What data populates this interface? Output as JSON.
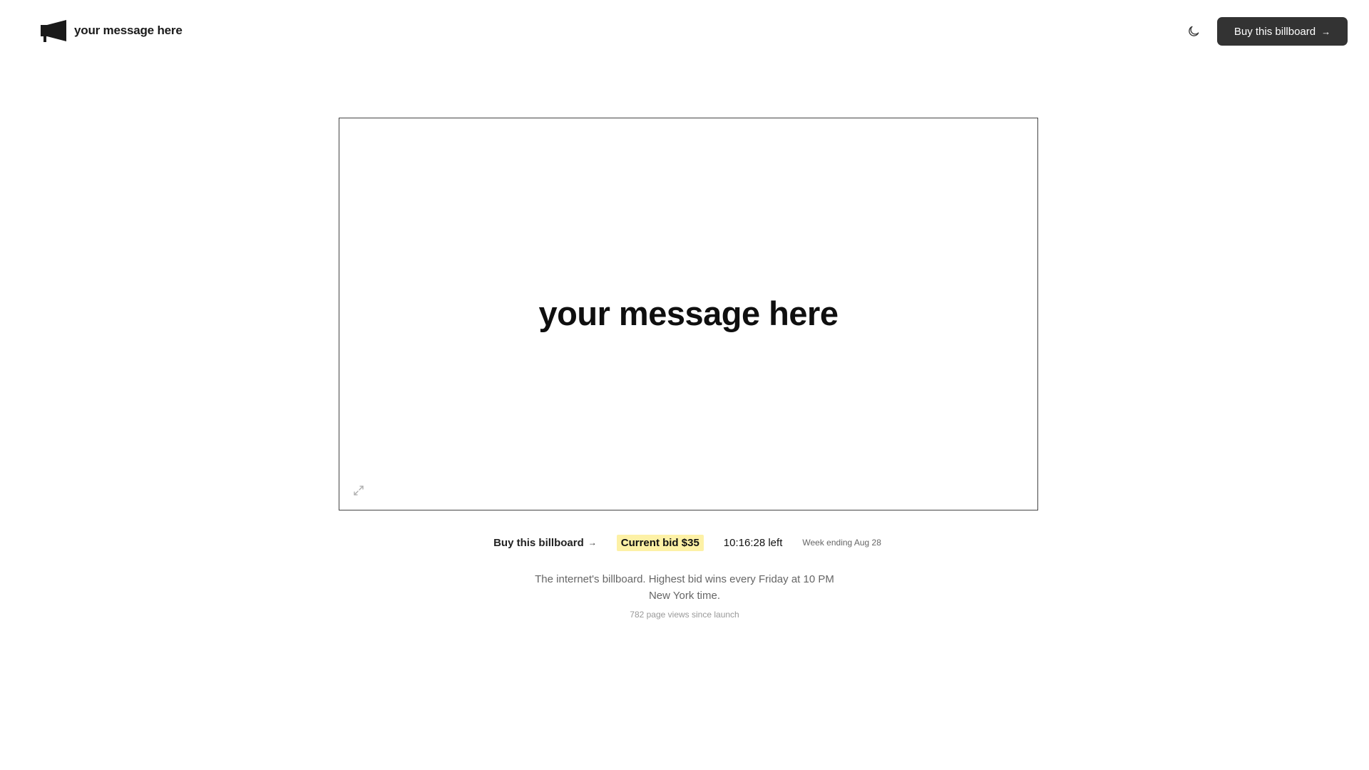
{
  "header": {
    "brand_name": "your message here",
    "logo_icon": "megaphone-icon",
    "theme_toggle_icon": "moon-icon",
    "buy_button_label": "Buy this billboard",
    "buy_button_arrow": "→"
  },
  "billboard": {
    "message": "your message here",
    "expand_icon": "expand-icon"
  },
  "info": {
    "buy_link_label": "Buy this billboard",
    "buy_link_arrow": "→",
    "current_bid": "Current bid $35",
    "time_left": "10:16:28 left",
    "week_ending": "Week ending Aug 28"
  },
  "footer": {
    "tagline_line1": "The internet's billboard. Highest bid wins every Friday at 10 PM",
    "tagline_line2": "New York time.",
    "page_views": "782 page views since launch"
  },
  "colors": {
    "button_bg": "#333333",
    "bid_highlight": "#fdf1a6",
    "billboard_border": "#444444"
  }
}
